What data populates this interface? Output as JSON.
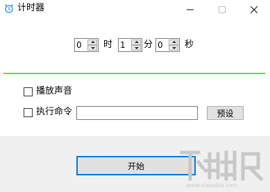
{
  "window": {
    "title": "计时器",
    "icon": "alarm-clock-icon",
    "controls": {
      "minimize_icon": "minimize-icon",
      "maximize_icon": "maximize-icon",
      "close_icon": "close-icon"
    }
  },
  "timer": {
    "hours": {
      "value": "0",
      "unit": "时"
    },
    "minutes": {
      "value": "1",
      "unit": "分"
    },
    "seconds": {
      "value": "0",
      "unit": "秒"
    }
  },
  "options": {
    "play_sound": {
      "label": "播放声音",
      "checked": false
    },
    "run_command": {
      "label": "执行命令",
      "checked": false,
      "value": "",
      "preset_label": "预设"
    }
  },
  "actions": {
    "start_label": "开始"
  },
  "watermark": {
    "text": "下载吧",
    "url": "www.xiazaiba.com"
  },
  "colors": {
    "separator": "#5fd35f",
    "focus_border": "#0078d7",
    "icon_blue": "#1e88e5"
  }
}
